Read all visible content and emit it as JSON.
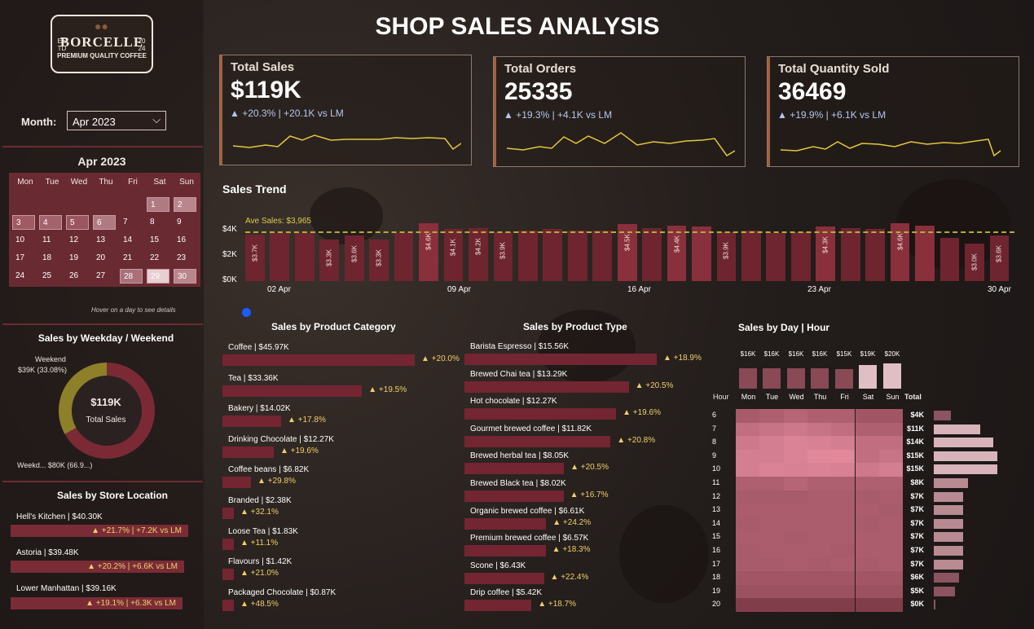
{
  "brand": {
    "est": "ES TD",
    "year": "20 24",
    "name": "BORCELLE",
    "tagline": "PREMIUM QUALITY COFFEE"
  },
  "title": "SHOP SALES ANALYSIS",
  "filter": {
    "label": "Month:",
    "value": "Apr 2023"
  },
  "calendar": {
    "title": "Apr 2023",
    "days": [
      "Mon",
      "Tue",
      "Wed",
      "Thu",
      "Fri",
      "Sat",
      "Sun"
    ],
    "dates": [
      "1",
      "2",
      "3",
      "4",
      "5",
      "6",
      "7",
      "8",
      "9",
      "10",
      "11",
      "12",
      "13",
      "14",
      "15",
      "16",
      "17",
      "18",
      "19",
      "20",
      "21",
      "22",
      "23",
      "24",
      "25",
      "26",
      "27",
      "28",
      "29",
      "30"
    ],
    "hint": "Hover on a day to see details"
  },
  "kpis": [
    {
      "title": "Total Sales",
      "value": "$119K",
      "delta": "▲ +20.3% | +20.1K vs LM"
    },
    {
      "title": "Total Orders",
      "value": "25335",
      "delta": "▲ +19.3% | +4.1K vs LM"
    },
    {
      "title": "Total Quantity Sold",
      "value": "36469",
      "delta": "▲ +19.9% | +6.1K vs LM"
    }
  ],
  "weekday": {
    "title": "Sales by Weekday / Weekend",
    "center_value": "$119K",
    "center_label": "Total Sales",
    "weekend_label": "Weekend",
    "weekend_value": "$39K (33.08%)",
    "weekday_label": "Weekd... $80K (66.9...)"
  },
  "stores": {
    "title": "Sales by Store Location",
    "items": [
      {
        "name": "Hell's Kitchen | $40.30K",
        "delta": "▲ +21.7% | +7.2K vs LM"
      },
      {
        "name": "Astoria | $39.48K",
        "delta": "▲ +20.2% | +6.6K vs LM"
      },
      {
        "name": "Lower Manhattan | $39.16K",
        "delta": "▲ +19.1% | +6.3K vs LM"
      }
    ]
  },
  "colors": {
    "bar": "#7b2833",
    "accent": "#f1cf68",
    "avg": "#b3ad3a",
    "delta_blue": "#b5c6f0"
  },
  "chart_data": [
    {
      "type": "bar",
      "title": "Sales Trend",
      "avg_label": "Ave Sales: $3,965",
      "avg": 3965,
      "ylim": [
        0,
        4800
      ],
      "yticks": [
        "$0K",
        "$2K",
        "$4K"
      ],
      "xticks": [
        "02 Apr",
        "09 Apr",
        "16 Apr",
        "23 Apr",
        "30 Apr"
      ],
      "values": [
        3.7,
        3.8,
        3.8,
        3.3,
        3.6,
        3.3,
        3.8,
        4.6,
        4.1,
        4.2,
        3.9,
        4.0,
        4.1,
        4.0,
        4.0,
        4.5,
        4.2,
        4.4,
        4.3,
        3.9,
        4.0,
        3.8,
        3.9,
        4.3,
        4.2,
        4.1,
        4.6,
        4.4,
        3.4,
        3.0,
        3.6
      ],
      "labels": [
        "$3.7K",
        "",
        "",
        "$3.3K",
        "$3.6K",
        "$3.3K",
        "",
        "$4.6K",
        "$4.1K",
        "$4.2K",
        "$3.9K",
        "",
        "",
        "",
        "",
        "$4.5K",
        "",
        "$4.4K",
        "",
        "$3.9K",
        "",
        "",
        "",
        "$4.3K",
        "",
        "",
        "$4.6K",
        "",
        "",
        "$3.0K",
        "$3.6K"
      ]
    },
    {
      "type": "bar",
      "title": "Sales by Product Category",
      "categories": [
        "Coffee | $45.97K",
        "Tea | $33.36K",
        "Bakery | $14.02K",
        "Drinking Chocolate | $12.27K",
        "Coffee beans | $6.82K",
        "Branded | $2.38K",
        "Loose Tea | $1.83K",
        "Flavours | $1.42K",
        "Packaged Chocolate | $0.87K"
      ],
      "values": [
        45.97,
        33.36,
        14.02,
        12.27,
        6.82,
        2.38,
        1.83,
        1.42,
        0.87
      ],
      "deltas": [
        "▲ +20.0%",
        "▲ +19.5%",
        "▲ +17.8%",
        "▲ +19.6%",
        "▲ +29.8%",
        "▲ +32.1%",
        "▲ +11.1%",
        "▲ +21.0%",
        "▲ +48.5%"
      ]
    },
    {
      "type": "bar",
      "title": "Sales by Product Type",
      "categories": [
        "Barista Espresso | $15.56K",
        "Brewed Chai tea | $13.29K",
        "Hot chocolate | $12.27K",
        "Gourmet brewed coffee | $11.82K",
        "Brewed herbal tea | $8.05K",
        "Brewed Black tea | $8.02K",
        "Organic brewed coffee | $6.61K",
        "Premium brewed coffee | $6.57K",
        "Scone | $6.43K",
        "Drip coffee | $5.42K"
      ],
      "values": [
        15.56,
        13.29,
        12.27,
        11.82,
        8.05,
        8.02,
        6.61,
        6.57,
        6.43,
        5.42
      ],
      "deltas": [
        "▲ +18.9%",
        "▲ +20.5%",
        "▲ +19.6%",
        "▲ +20.8%",
        "▲ +20.5%",
        "▲ +16.7%",
        "▲ +24.2%",
        "▲ +18.3%",
        "▲ +22.4%",
        "▲ +18.7%"
      ]
    },
    {
      "type": "heatmap",
      "title": "Sales by Day | Hour",
      "hour_label": "Hour",
      "total_label": "Total",
      "days": [
        "Mon",
        "Tue",
        "Wed",
        "Thu",
        "Fri",
        "Sat",
        "Sun"
      ],
      "day_totals": [
        "$16K",
        "$16K",
        "$16K",
        "$16K",
        "$15K",
        "$19K",
        "$20K"
      ],
      "day_values": [
        16,
        16,
        16,
        16,
        15,
        19,
        20
      ],
      "hours": [
        "6",
        "7",
        "8",
        "9",
        "10",
        "11",
        "12",
        "13",
        "14",
        "15",
        "16",
        "17",
        "18",
        "19",
        "20"
      ],
      "hour_totals": [
        "$4K",
        "$11K",
        "$14K",
        "$15K",
        "$15K",
        "$8K",
        "$7K",
        "$7K",
        "$7K",
        "$7K",
        "$7K",
        "$7K",
        "$6K",
        "$5K",
        "$0K"
      ],
      "hour_values": [
        4,
        11,
        14,
        15,
        15,
        8,
        7,
        7,
        7,
        7,
        7,
        7,
        6,
        5,
        0.3
      ],
      "cells": [
        [
          0.4,
          0.45,
          0.5,
          0.45,
          0.45,
          0.35,
          0.35
        ],
        [
          0.6,
          0.65,
          0.7,
          0.65,
          0.6,
          0.45,
          0.45
        ],
        [
          0.7,
          0.75,
          0.8,
          0.78,
          0.75,
          0.6,
          0.6
        ],
        [
          0.75,
          0.75,
          0.8,
          0.85,
          0.85,
          0.6,
          0.65
        ],
        [
          0.75,
          0.8,
          0.78,
          0.8,
          0.78,
          0.7,
          0.75
        ],
        [
          0.45,
          0.45,
          0.5,
          0.45,
          0.45,
          0.45,
          0.45
        ],
        [
          0.4,
          0.4,
          0.4,
          0.42,
          0.42,
          0.4,
          0.42
        ],
        [
          0.42,
          0.42,
          0.42,
          0.42,
          0.42,
          0.42,
          0.4
        ],
        [
          0.4,
          0.42,
          0.42,
          0.42,
          0.42,
          0.4,
          0.42
        ],
        [
          0.42,
          0.42,
          0.4,
          0.42,
          0.42,
          0.42,
          0.42
        ],
        [
          0.4,
          0.42,
          0.42,
          0.42,
          0.4,
          0.42,
          0.42
        ],
        [
          0.4,
          0.4,
          0.42,
          0.4,
          0.42,
          0.4,
          0.42
        ],
        [
          0.35,
          0.35,
          0.35,
          0.35,
          0.35,
          0.35,
          0.35
        ],
        [
          0.3,
          0.3,
          0.3,
          0.3,
          0.3,
          0.3,
          0.3
        ],
        [
          0.1,
          0.1,
          0.1,
          0.1,
          0.1,
          0.1,
          0.1
        ]
      ]
    }
  ]
}
